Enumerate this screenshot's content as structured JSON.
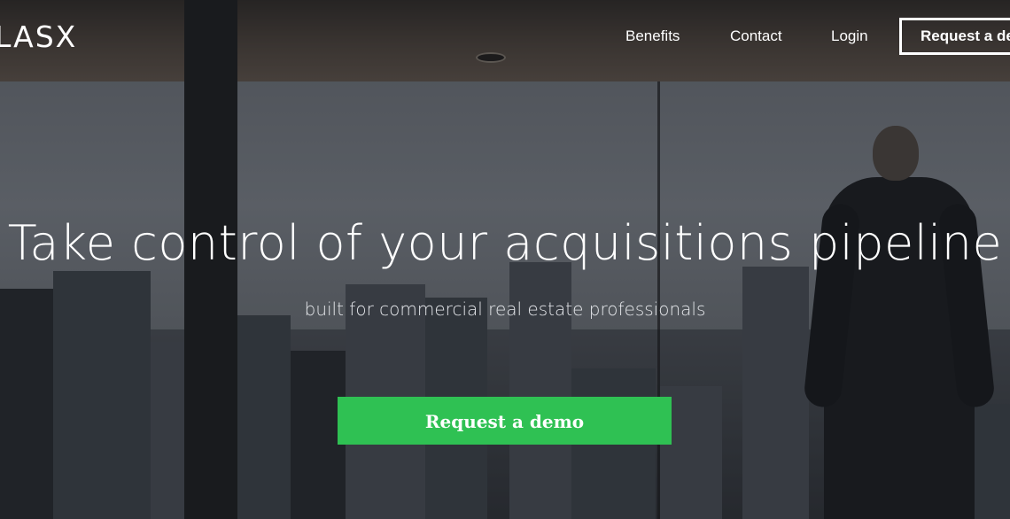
{
  "brand": {
    "logo_text": "LASX"
  },
  "nav": {
    "items": [
      {
        "label": "Benefits"
      },
      {
        "label": "Contact"
      },
      {
        "label": "Login"
      }
    ],
    "cta_label": "Request a demo"
  },
  "hero": {
    "headline": "Take control of your acquisitions pipeline",
    "subheadline": "built for commercial real estate professionals",
    "cta_label": "Request a demo"
  },
  "colors": {
    "cta_green": "#2fc153",
    "text_white": "#ffffff"
  }
}
